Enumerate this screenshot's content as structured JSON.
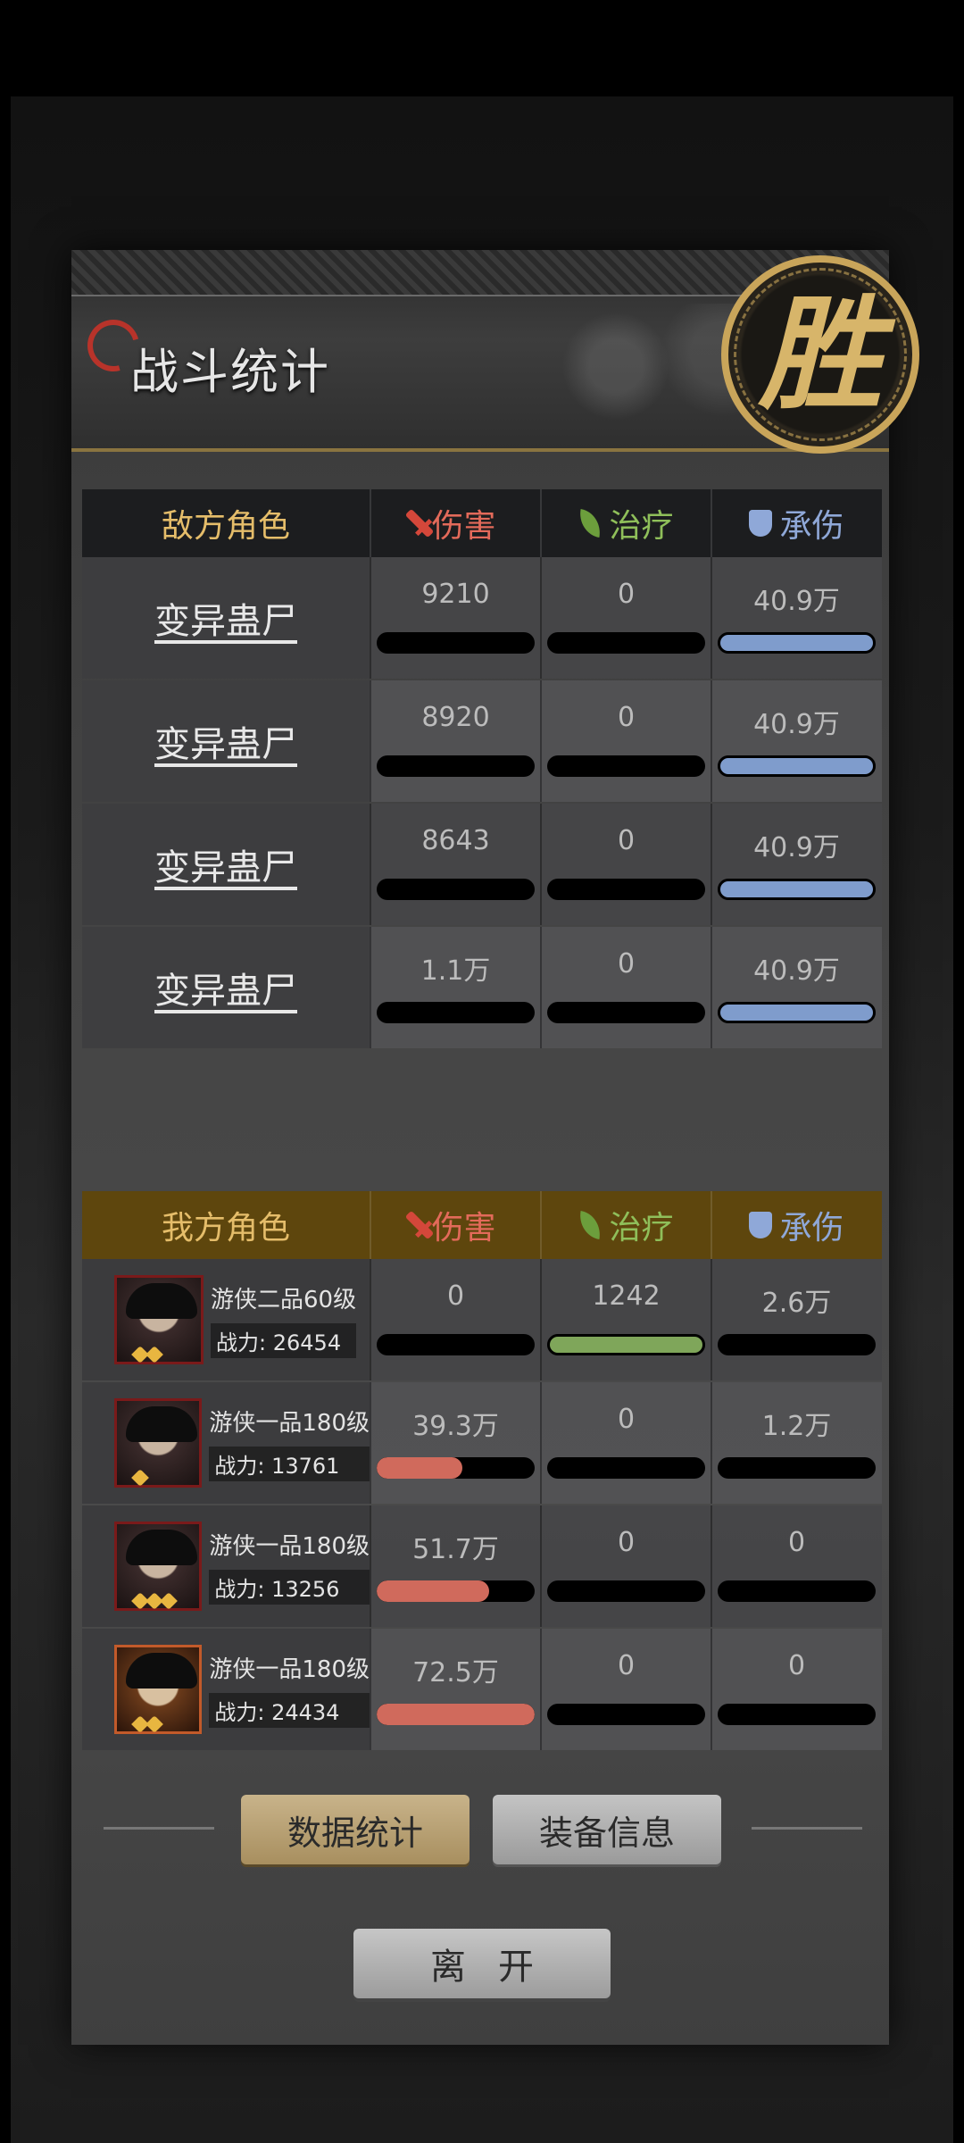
{
  "title": "战斗统计",
  "victory": "胜",
  "enemy_table": {
    "header": {
      "name": "敌方角色",
      "damage": "伤害",
      "heal": "治疗",
      "tank": "承伤"
    },
    "rows": [
      {
        "name": "变异蛊尸",
        "damage": "9210",
        "heal": "0",
        "tank": "40.9万",
        "damage_fill": 0,
        "heal_fill": 0,
        "tank_fill": 1.0
      },
      {
        "name": "变异蛊尸",
        "damage": "8920",
        "heal": "0",
        "tank": "40.9万",
        "damage_fill": 0,
        "heal_fill": 0,
        "tank_fill": 1.0
      },
      {
        "name": "变异蛊尸",
        "damage": "8643",
        "heal": "0",
        "tank": "40.9万",
        "damage_fill": 0,
        "heal_fill": 0,
        "tank_fill": 1.0
      },
      {
        "name": "变异蛊尸",
        "damage": "1.1万",
        "heal": "0",
        "tank": "40.9万",
        "damage_fill": 0,
        "heal_fill": 0,
        "tank_fill": 1.0
      }
    ]
  },
  "ally_table": {
    "header": {
      "name": "我方角色",
      "damage": "伤害",
      "heal": "治疗",
      "tank": "承伤"
    },
    "rows": [
      {
        "rank": "游侠二品60级",
        "power_label": "战力:",
        "power": "26454",
        "stars": 2,
        "damage": "0",
        "heal": "1242",
        "tank": "2.6万",
        "damage_fill": 0,
        "heal_fill": 1.0,
        "tank_fill": 0
      },
      {
        "rank": "游侠一品180级",
        "power_label": "战力:",
        "power": "13761",
        "stars": 1,
        "damage": "39.3万",
        "heal": "0",
        "tank": "1.2万",
        "damage_fill": 0.54,
        "heal_fill": 0,
        "tank_fill": 0
      },
      {
        "rank": "游侠一品180级",
        "power_label": "战力:",
        "power": "13256",
        "stars": 3,
        "damage": "51.7万",
        "heal": "0",
        "tank": "0",
        "damage_fill": 0.71,
        "heal_fill": 0,
        "tank_fill": 0
      },
      {
        "rank": "游侠一品180级",
        "power_label": "战力:",
        "power": "24434",
        "stars": 2,
        "damage": "72.5万",
        "heal": "0",
        "tank": "0",
        "damage_fill": 1.0,
        "heal_fill": 0,
        "tank_fill": 0
      }
    ]
  },
  "buttons": {
    "data_stats": "数据统计",
    "equip_info": "装备信息",
    "leave": "离开"
  },
  "icons": {
    "damage": "sword-icon",
    "heal": "leaf-icon",
    "tank": "shield-icon"
  },
  "colors": {
    "damage": "#d06a5c",
    "heal": "#7fa65a",
    "tank": "#7f9ccc",
    "ally_header": "#5e460d",
    "enemy_header": "#1c1d1f"
  }
}
